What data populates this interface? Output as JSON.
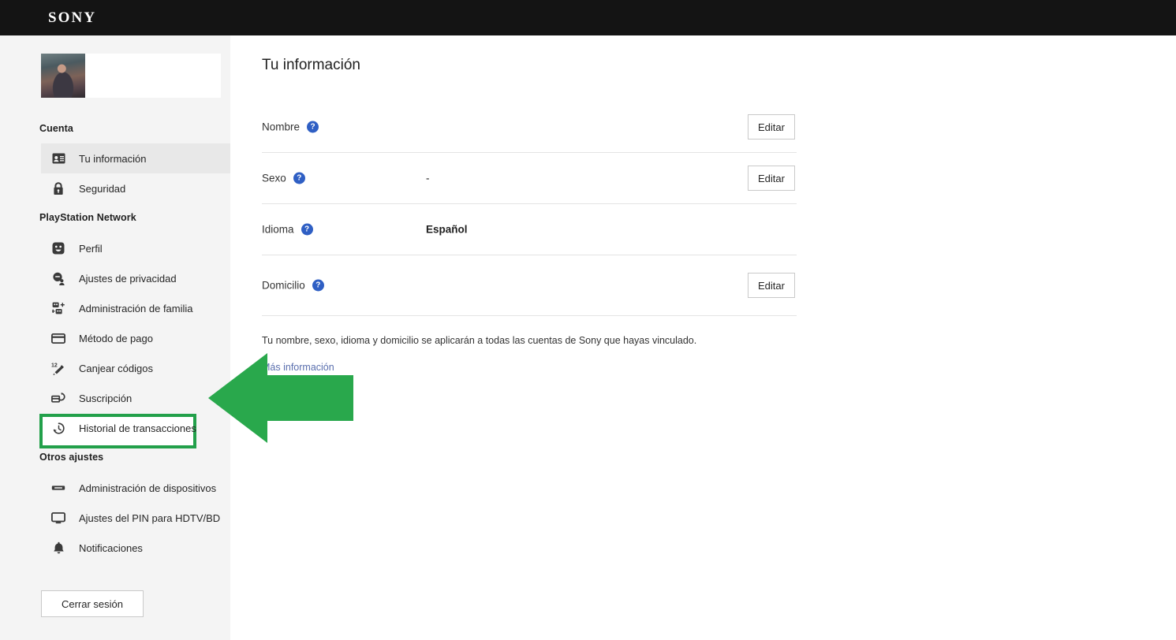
{
  "header": {
    "brand": "SONY",
    "brand_icon": "sony-wordmark"
  },
  "sidebar": {
    "profile": {
      "avatar_icon": "user-avatar-photo",
      "display_name": ""
    },
    "sections": [
      {
        "heading": "Cuenta",
        "items": [
          {
            "label": "Tu información",
            "icon": "id-card-icon",
            "active": true
          },
          {
            "label": "Seguridad",
            "icon": "lock-icon",
            "active": false
          }
        ]
      },
      {
        "heading": "PlayStation Network",
        "items": [
          {
            "label": "Perfil",
            "icon": "smiley-face-icon",
            "active": false
          },
          {
            "label": "Ajustes de privacidad",
            "icon": "privacy-shield-person-icon",
            "active": false
          },
          {
            "label": "Administración de familia",
            "icon": "family-group-icon",
            "active": false
          },
          {
            "label": "Método de pago",
            "icon": "credit-card-icon",
            "active": false
          },
          {
            "label": "Canjear códigos",
            "icon": "redeem-code-icon",
            "active": false
          },
          {
            "label": "Suscripción",
            "icon": "subscription-refresh-icon",
            "active": false
          },
          {
            "label": "Historial de transacciones",
            "icon": "history-clock-icon",
            "active": false,
            "highlighted": true
          }
        ]
      },
      {
        "heading": "Otros ajustes",
        "items": [
          {
            "label": "Administración de dispositivos",
            "icon": "device-icon",
            "active": false
          },
          {
            "label": "Ajustes del PIN para HDTV/BD",
            "icon": "monitor-icon",
            "active": false
          },
          {
            "label": "Notificaciones",
            "icon": "bell-icon",
            "active": false
          }
        ]
      }
    ],
    "logout_label": "Cerrar sesión"
  },
  "main": {
    "title": "Tu información",
    "rows": [
      {
        "label": "Nombre",
        "help_icon": "help-question-icon",
        "value": "",
        "action_label": "Editar",
        "has_action": true
      },
      {
        "label": "Sexo",
        "help_icon": "help-question-icon",
        "value": "-",
        "action_label": "Editar",
        "has_action": true
      },
      {
        "label": "Idioma",
        "help_icon": "help-question-icon",
        "value": "Español",
        "value_bold": true,
        "has_action": false
      },
      {
        "label": "Domicilio",
        "help_icon": "help-question-icon",
        "value": "",
        "action_label": "Editar",
        "has_action": true
      }
    ],
    "footnote": "Tu nombre, sexo, idioma y domicilio se aplicarán a todas las cuentas de Sony que hayas vinculado.",
    "more_info_label": "Más información"
  },
  "annotation": {
    "arrow_icon": "left-pointing-arrow",
    "arrow_color": "#29a84c",
    "highlight_color": "#22a04a",
    "highlight_target": "Historial de transacciones"
  },
  "colors": {
    "topbar_bg": "#141414",
    "sidebar_bg": "#f4f4f4",
    "active_item_bg": "#e8e8e8",
    "help_icon_blue": "#2f5fc4",
    "link_blue": "#5a6fae",
    "green_accent": "#29a84c"
  }
}
